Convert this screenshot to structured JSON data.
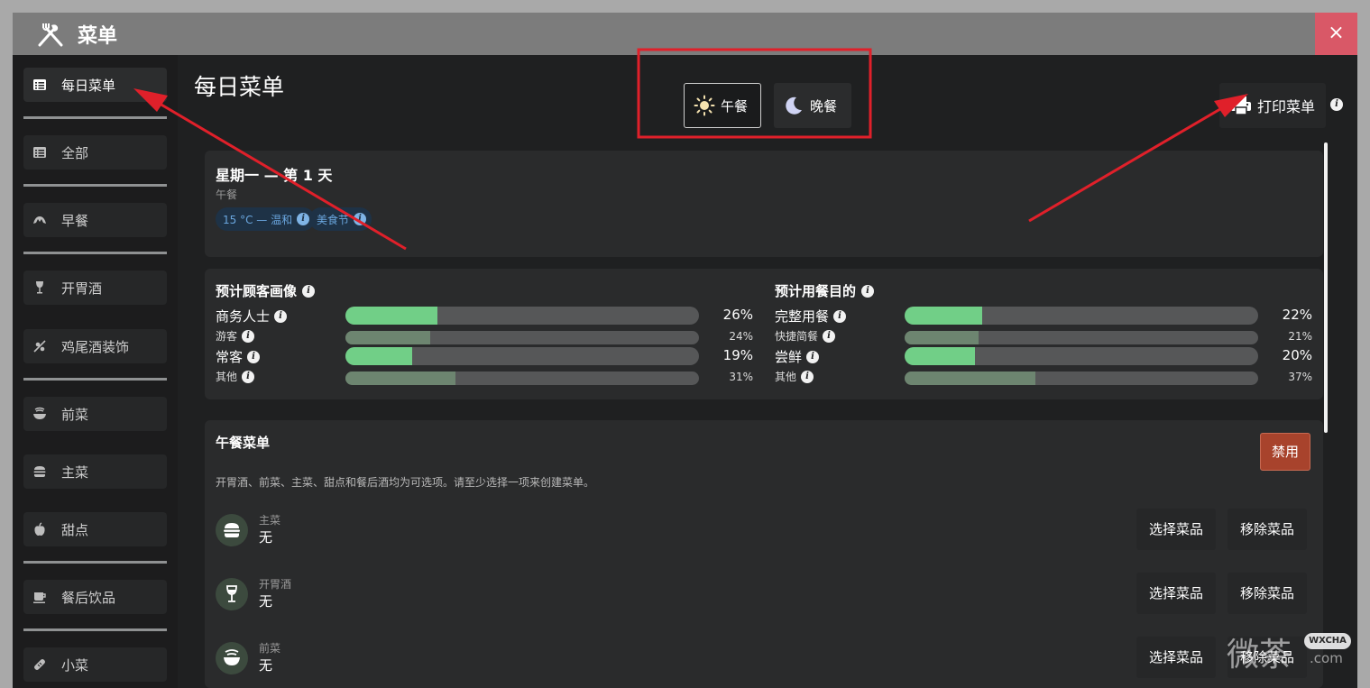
{
  "app": {
    "title": "菜单",
    "close_icon": "×"
  },
  "sidebar": {
    "items": [
      {
        "label": "每日菜单",
        "icon": "list-icon"
      },
      {
        "label": "全部",
        "icon": "list-icon"
      },
      {
        "label": "早餐",
        "icon": "croissant-icon"
      },
      {
        "label": "开胃酒",
        "icon": "wine-glass-icon"
      },
      {
        "label": "鸡尾酒装饰",
        "icon": "garnish-icon"
      },
      {
        "label": "前菜",
        "icon": "bowl-icon"
      },
      {
        "label": "主菜",
        "icon": "burger-icon"
      },
      {
        "label": "甜点",
        "icon": "apple-icon"
      },
      {
        "label": "餐后饮品",
        "icon": "coffee-icon"
      },
      {
        "label": "小菜",
        "icon": "bread-icon"
      }
    ]
  },
  "header": {
    "page_title": "每日菜单",
    "lunch_label": "午餐",
    "dinner_label": "晚餐",
    "print_label": "打印菜单"
  },
  "day": {
    "title": "星期一 — 第 1 天",
    "subtitle": "午餐",
    "chips": [
      "15 °C — 温和",
      "美食节"
    ]
  },
  "stats": {
    "guests": {
      "title": "预计顾客画像",
      "rows": [
        {
          "label": "商务人士",
          "pct": "26%",
          "value": 26,
          "major": true
        },
        {
          "label": "游客",
          "pct": "24%",
          "value": 24,
          "major": false
        },
        {
          "label": "常客",
          "pct": "19%",
          "value": 19,
          "major": true
        },
        {
          "label": "其他",
          "pct": "31%",
          "value": 31,
          "major": false
        }
      ]
    },
    "purpose": {
      "title": "预计用餐目的",
      "rows": [
        {
          "label": "完整用餐",
          "pct": "22%",
          "value": 22,
          "major": true
        },
        {
          "label": "快捷简餐",
          "pct": "21%",
          "value": 21,
          "major": false
        },
        {
          "label": "尝鲜",
          "pct": "20%",
          "value": 20,
          "major": true
        },
        {
          "label": "其他",
          "pct": "37%",
          "value": 37,
          "major": false
        }
      ]
    }
  },
  "menu": {
    "title": "午餐菜单",
    "disable_label": "禁用",
    "description": "开胃酒、前菜、主菜、甜点和餐后酒均为可选项。请至少选择一项来创建菜单。",
    "select_label": "选择菜品",
    "remove_label": "移除菜品",
    "courses": [
      {
        "name": "主菜",
        "value": "无",
        "icon": "burger-icon"
      },
      {
        "name": "开胃酒",
        "value": "无",
        "icon": "wine-glass-icon"
      },
      {
        "name": "前菜",
        "value": "无",
        "icon": "bowl-icon"
      }
    ]
  },
  "colors": {
    "accent_green": "#71cf87",
    "muted_green": "#6d8570",
    "annotation_red": "#e0202a",
    "disable_red": "#a8432c"
  },
  "watermark": {
    "text": "微茶",
    "tag": "WXCHA",
    "sub": ".com"
  }
}
